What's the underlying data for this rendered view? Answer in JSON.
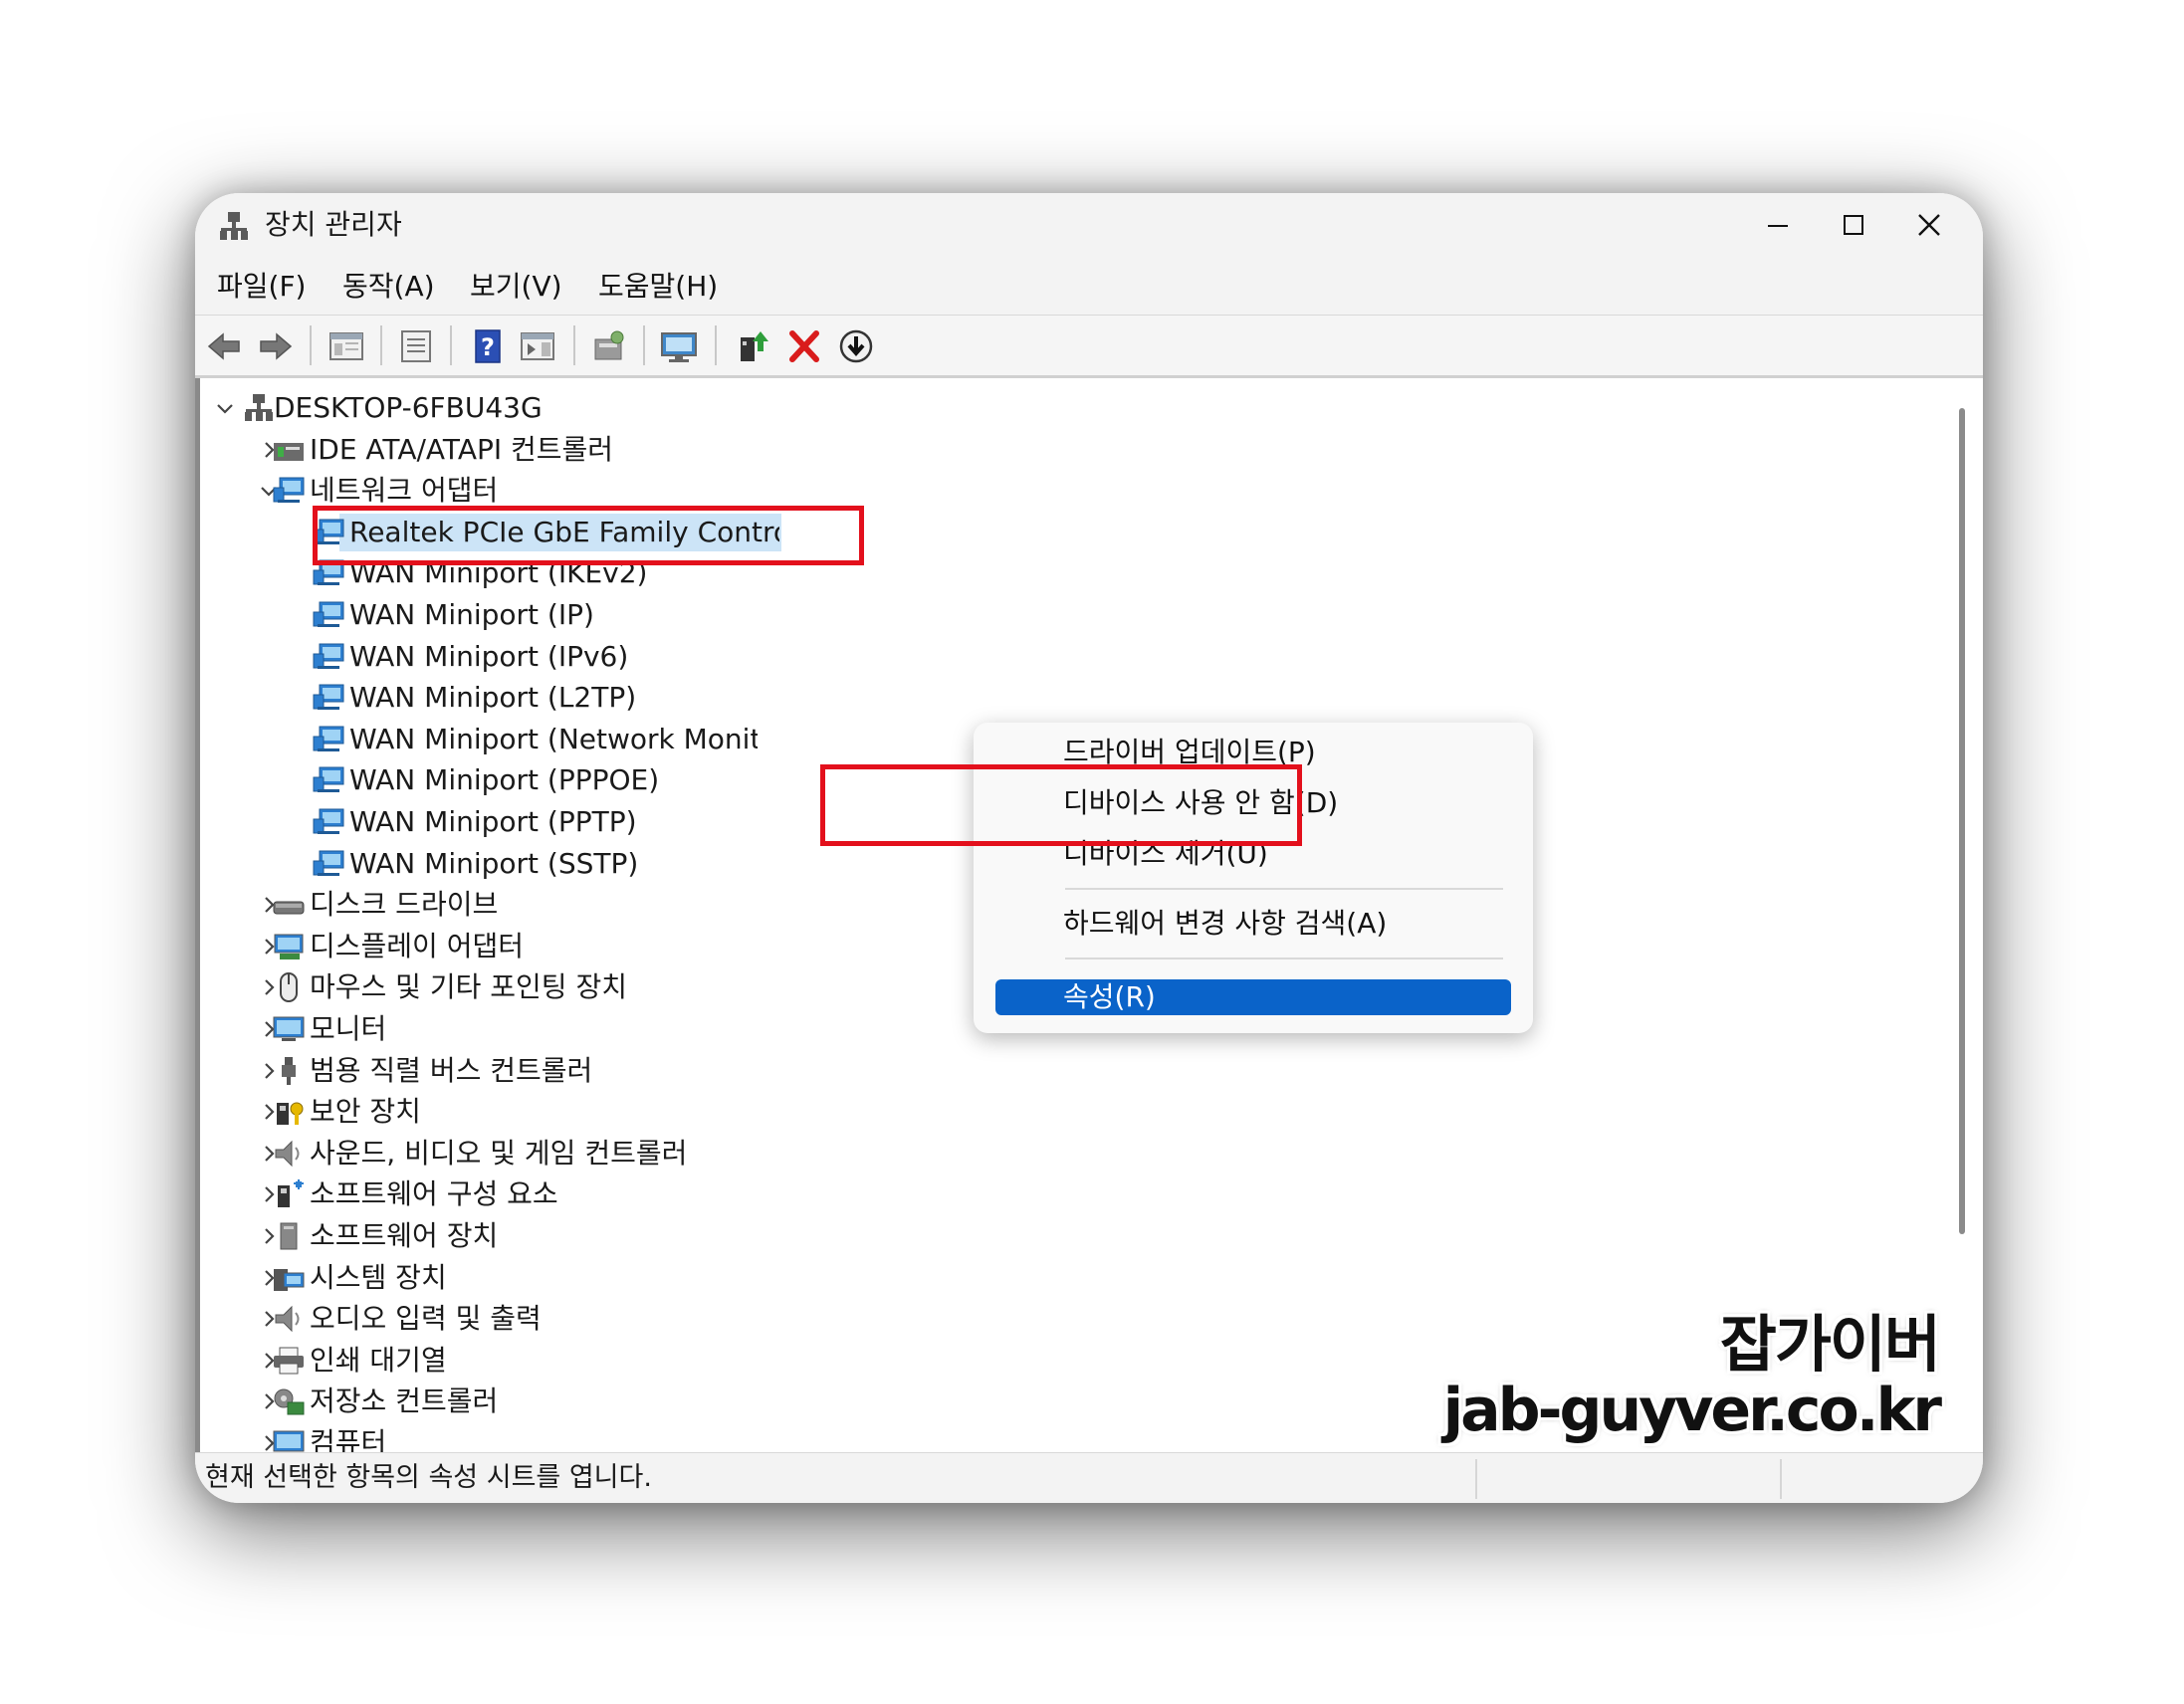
{
  "window": {
    "title": "장치 관리자",
    "controls": {
      "minimize": "—",
      "maximize": "☐",
      "close": "✕"
    }
  },
  "menu": [
    "파일(F)",
    "동작(A)",
    "보기(V)",
    "도움말(H)"
  ],
  "toolbar": {
    "icons": [
      "back-arrow-icon",
      "forward-arrow-icon",
      "show-hide-console-tree-icon",
      "properties-sheet-icon",
      "help-icon",
      "action-pane-icon",
      "scan-hardware-icon",
      "monitor-icon",
      "update-driver-icon",
      "uninstall-icon",
      "disable-device-icon"
    ]
  },
  "tree": {
    "root": "DESKTOP-6FBU43G",
    "ide": "IDE ATA/ATAPI 컨트롤러",
    "network": "네트워크 어댑터",
    "network_children": [
      "Realtek PCIe GbE Family Controller",
      "WAN Miniport (IKEv2)",
      "WAN Miniport (IP)",
      "WAN Miniport (IPv6)",
      "WAN Miniport (L2TP)",
      "WAN Miniport (Network Monitor)",
      "WAN Miniport (PPPOE)",
      "WAN Miniport (PPTP)",
      "WAN Miniport (SSTP)"
    ],
    "categories": [
      "디스크 드라이브",
      "디스플레이 어댑터",
      "마우스 및 기타 포인팅 장치",
      "모니터",
      "범용 직렬 버스 컨트롤러",
      "보안 장치",
      "사운드, 비디오 및 게임 컨트롤러",
      "소프트웨어 구성 요소",
      "소프트웨어 장치",
      "시스템 장치",
      "오디오 입력 및 출력",
      "인쇄 대기열",
      "저장소 컨트롤러",
      "컴퓨터"
    ]
  },
  "context_menu": {
    "update_driver": "드라이버 업데이트(P)",
    "disable_device": "디바이스 사용 안 함(D)",
    "uninstall_device": "디바이스 제거(U)",
    "scan_hardware": "하드웨어 변경 사항 검색(A)",
    "properties": "속성(R)"
  },
  "status_bar": "현재 선택한 항목의 속성 시트를 엽니다.",
  "watermark": {
    "line1": "잡가이버",
    "line2": "jab-guyver.co.kr"
  },
  "colors": {
    "highlight_box": "#e3101c",
    "menu_selection": "#0a63c9",
    "tree_selection": "#cce4f7"
  }
}
